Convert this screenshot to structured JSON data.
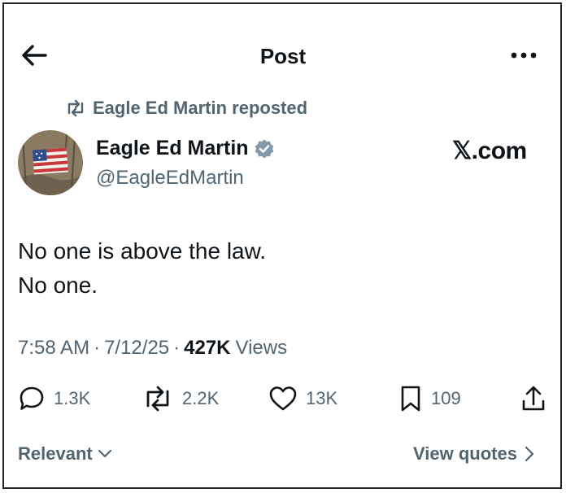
{
  "header": {
    "title": "Post"
  },
  "repost": {
    "label": "Eagle Ed Martin reposted"
  },
  "author": {
    "name": "Eagle Ed Martin",
    "handle": "@EagleEdMartin"
  },
  "watermark": "𝕏.com",
  "post": {
    "text": "No one is above the law.\nNo one."
  },
  "meta": {
    "time": "7:58 AM",
    "sep1": "·",
    "date": "7/12/25",
    "sep2": "·",
    "views_count": "427K",
    "views_label": "Views"
  },
  "actions": {
    "replies": "1.3K",
    "reposts": "2.2K",
    "likes": "13K",
    "bookmarks": "109"
  },
  "footer": {
    "sort_label": "Relevant",
    "view_quotes_label": "View quotes"
  },
  "colors": {
    "text": "#0f1419",
    "secondary": "#536471",
    "verified": "#829aab"
  },
  "icons": [
    "back-arrow-icon",
    "more-icon",
    "repost-icon",
    "verified-badge-icon",
    "reply-icon",
    "like-icon",
    "bookmark-icon",
    "share-icon",
    "chevron-down-icon",
    "chevron-right-icon"
  ]
}
